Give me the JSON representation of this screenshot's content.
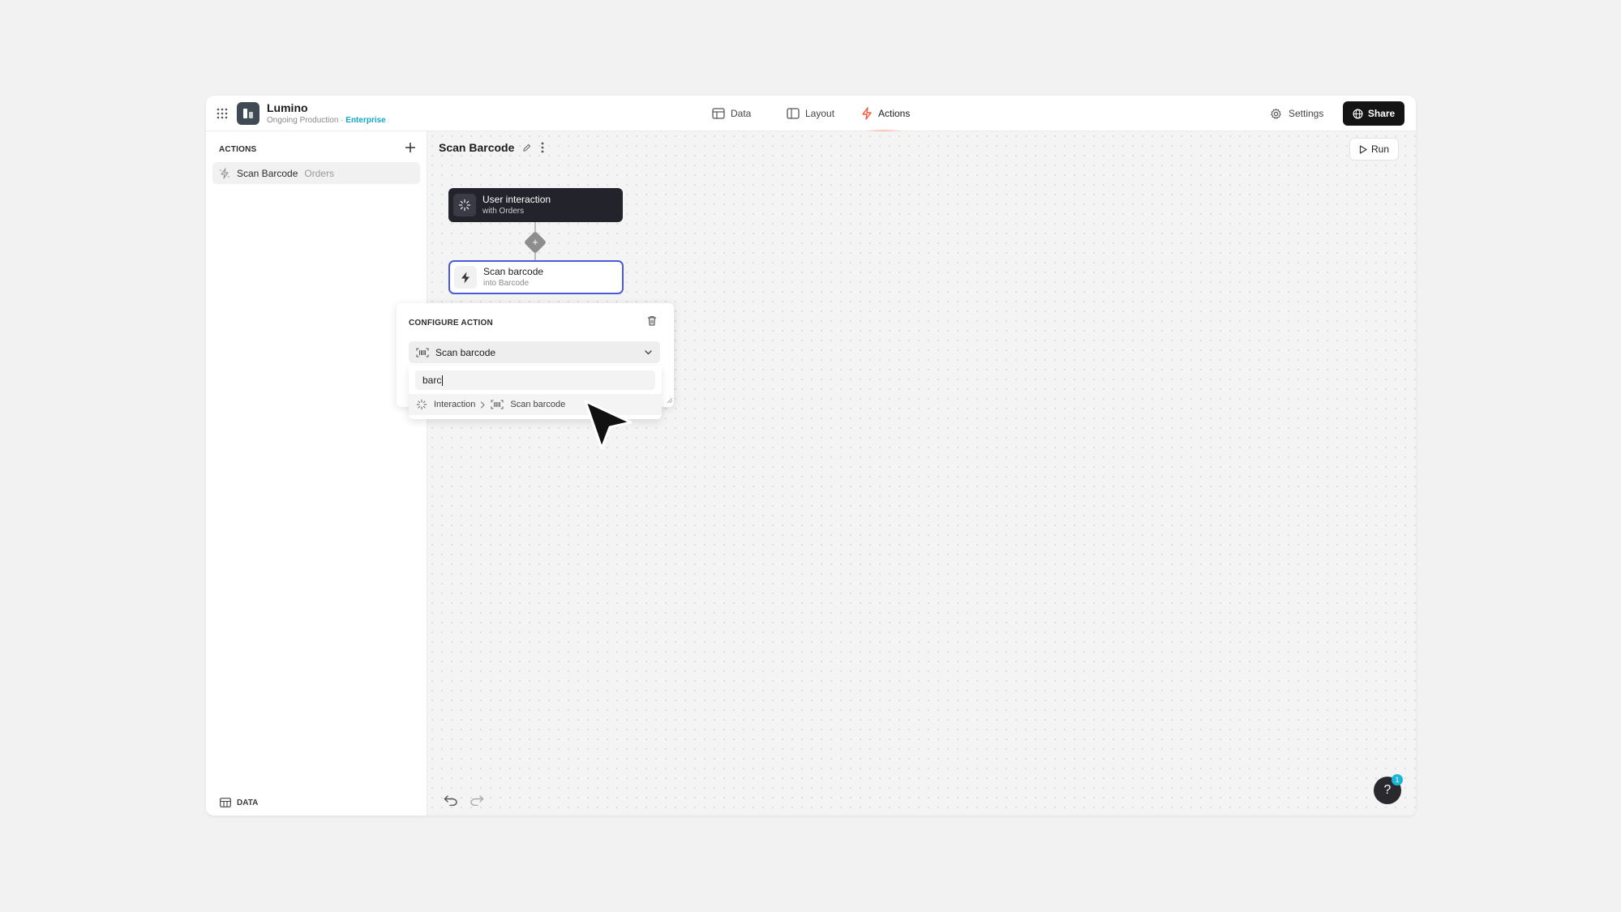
{
  "app": {
    "name": "Lumino",
    "subtitle": "Ongoing Production · ",
    "plan": "Enterprise",
    "plan_color": "#12a7c4"
  },
  "nav": {
    "tabs": [
      {
        "label": "Data",
        "icon": "table-icon"
      },
      {
        "label": "Layout",
        "icon": "layout-icon"
      },
      {
        "label": "Actions",
        "icon": "bolt-icon",
        "active": true
      }
    ],
    "settings_label": "Settings",
    "share_label": "Share"
  },
  "sidebar": {
    "title": "ACTIONS",
    "items": [
      {
        "label": "Scan Barcode",
        "meta": "Orders",
        "icon": "action-icon"
      }
    ],
    "bottom_label": "DATA"
  },
  "canvas": {
    "title": "Scan Barcode",
    "run_label": "Run",
    "trigger_node": {
      "title": "User interaction",
      "subtitle": "with Orders"
    },
    "action_node": {
      "title": "Scan barcode",
      "subtitle": "into Barcode"
    },
    "accent_color": "#4a5bd8"
  },
  "config": {
    "title": "CONFIGURE ACTION",
    "selected_action": "Scan barcode",
    "search_value": "barc",
    "results": [
      {
        "category": "Interaction",
        "action": "Scan barcode"
      }
    ]
  },
  "help": {
    "label": "?",
    "badge": "1"
  }
}
